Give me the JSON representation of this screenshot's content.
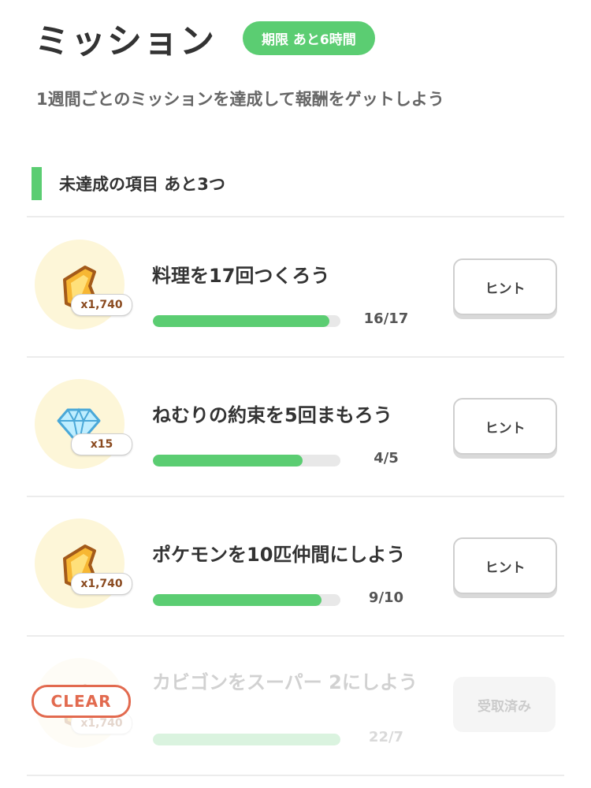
{
  "header": {
    "title": "ミッション",
    "deadline": "期限 あと6時間"
  },
  "subtitle": "1週間ごとのミッションを達成して報酬をゲットしよう",
  "section": {
    "title": "未達成の項目 あと3つ"
  },
  "colors": {
    "accent": "#5bcd72",
    "clear": "#e26a4f"
  },
  "missions": [
    {
      "title": "料理を17回つくろう",
      "reward_icon": "dream-shard-icon",
      "reward_count": "x1,740",
      "progress_text": "16/17",
      "progress": 0.94,
      "button_label": "ヒント"
    },
    {
      "title": "ねむりの約束を5回まもろう",
      "reward_icon": "diamond-icon",
      "reward_count": "x15",
      "progress_text": "4/5",
      "progress": 0.8,
      "button_label": "ヒント"
    },
    {
      "title": "ポケモンを10匹仲間にしよう",
      "reward_icon": "dream-shard-icon",
      "reward_count": "x1,740",
      "progress_text": "9/10",
      "progress": 0.9,
      "button_label": "ヒント"
    },
    {
      "title": "カビゴンをスーパー 2にしよう",
      "reward_icon": "dream-shard-icon",
      "reward_count": "x1,740",
      "progress_text": "22/7",
      "progress": 1.0,
      "button_label": "受取済み",
      "stamp": "CLEAR"
    }
  ]
}
